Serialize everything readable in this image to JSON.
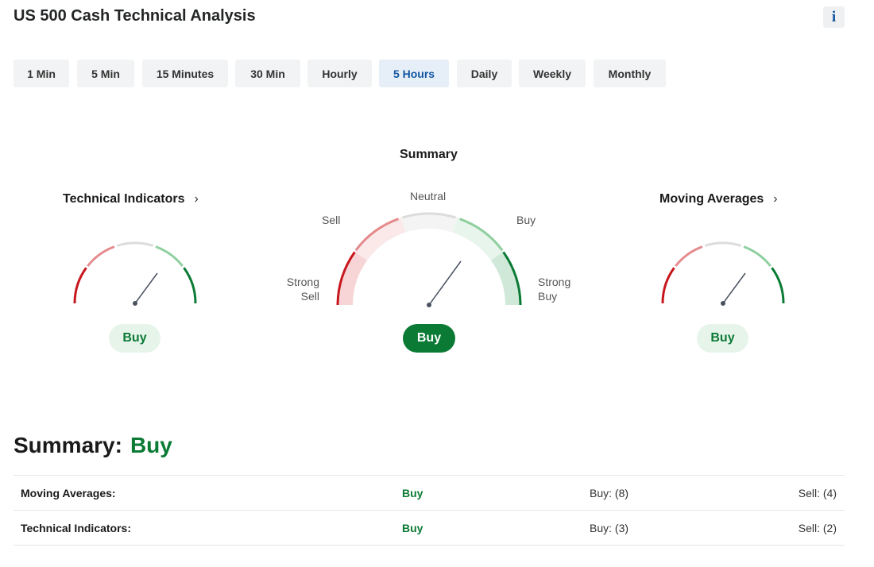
{
  "title": "US 500 Cash Technical Analysis",
  "info_icon": "i",
  "timeframes": {
    "active": "5 Hours",
    "items": [
      "1 Min",
      "5 Min",
      "15 Minutes",
      "30 Min",
      "Hourly",
      "5 Hours",
      "Daily",
      "Weekly",
      "Monthly"
    ]
  },
  "gauges": {
    "technical_indicators": {
      "title": "Technical Indicators",
      "chevron": "›",
      "signal": "Buy"
    },
    "summary": {
      "title": "Summary",
      "signal": "Buy",
      "labels": {
        "neutral": "Neutral",
        "sell": "Sell",
        "buy": "Buy",
        "strong_sell": "Strong\nSell",
        "strong_buy": "Strong\nBuy"
      }
    },
    "moving_averages": {
      "title": "Moving Averages",
      "chevron": "›",
      "signal": "Buy"
    }
  },
  "summary_section": {
    "label": "Summary:",
    "value": "Buy",
    "rows": [
      {
        "name": "Moving Averages:",
        "signal": "Buy",
        "buy": "Buy: (8)",
        "sell": "Sell: (4)"
      },
      {
        "name": "Technical Indicators:",
        "signal": "Buy",
        "buy": "Buy: (3)",
        "sell": "Sell: (2)"
      }
    ]
  },
  "colors": {
    "strong_sell": "#c8161d",
    "sell": "#e58a8d",
    "neutral": "#dcdcdc",
    "buy": "#8fcf9f",
    "strong_buy": "#0a7a34",
    "active_tab_text": "#1256a0"
  }
}
